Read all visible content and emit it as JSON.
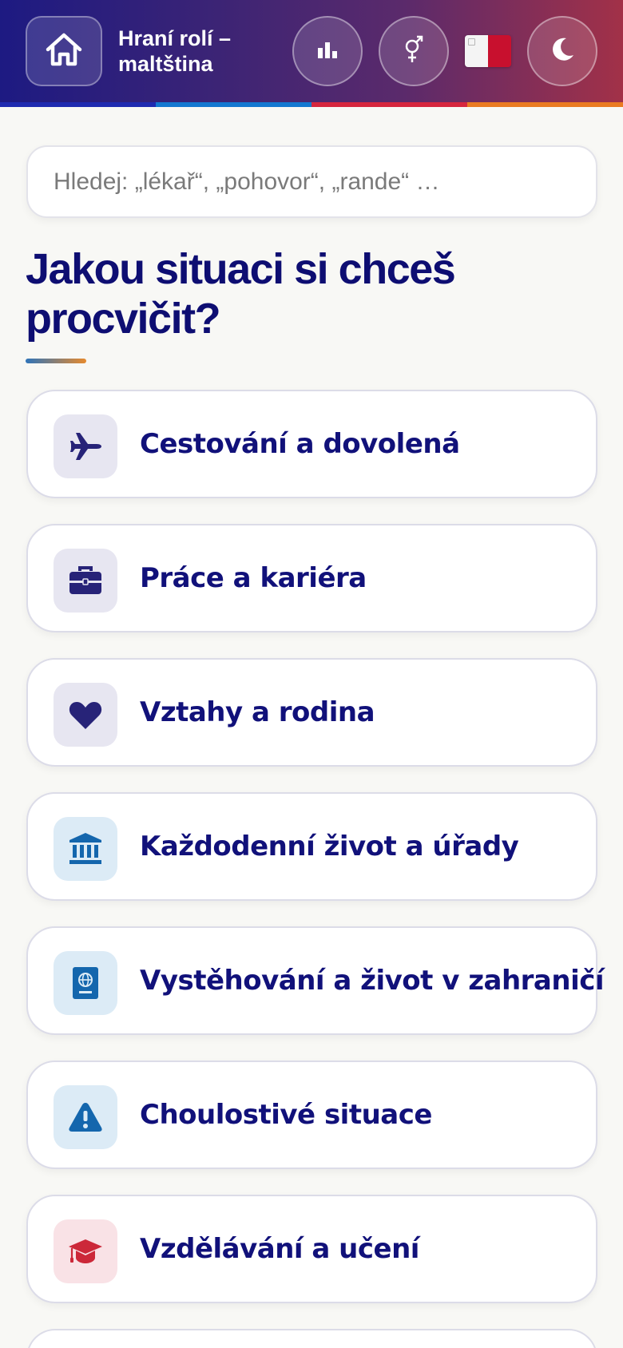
{
  "header": {
    "title": "Hraní rolí – maltština",
    "stripe_colors": [
      "#1f2bb0",
      "#1478d0",
      "#d6263e",
      "#ea7b22"
    ],
    "flag": "malta-flag"
  },
  "search": {
    "placeholder": "Hledej: „lékař“, „pohovor“, „rande“ …",
    "value": ""
  },
  "main": {
    "heading": "Jakou situaci si chceš procvičit?",
    "categories": [
      {
        "label": "Cestování a dovolená",
        "icon": "plane-icon",
        "icon_bg": "#e7e6f1",
        "icon_color": "#272378"
      },
      {
        "label": "Práce a kariéra",
        "icon": "briefcase-icon",
        "icon_bg": "#e7e6f1",
        "icon_color": "#272378"
      },
      {
        "label": "Vztahy a rodina",
        "icon": "heart-icon",
        "icon_bg": "#e7e6f1",
        "icon_color": "#272378"
      },
      {
        "label": "Každodenní život a úřady",
        "icon": "bank-icon",
        "icon_bg": "#dcebf6",
        "icon_color": "#1466ad"
      },
      {
        "label": "Vystěhování a život v zahraničí",
        "icon": "passport-icon",
        "icon_bg": "#dcebf6",
        "icon_color": "#1466ad"
      },
      {
        "label": "Choulostivé situace",
        "icon": "warning-icon",
        "icon_bg": "#dcebf6",
        "icon_color": "#1466ad"
      },
      {
        "label": "Vzdělávání a učení",
        "icon": "graduation-cap-icon",
        "icon_bg": "#f9e2e6",
        "icon_color": "#cc2839"
      }
    ]
  }
}
